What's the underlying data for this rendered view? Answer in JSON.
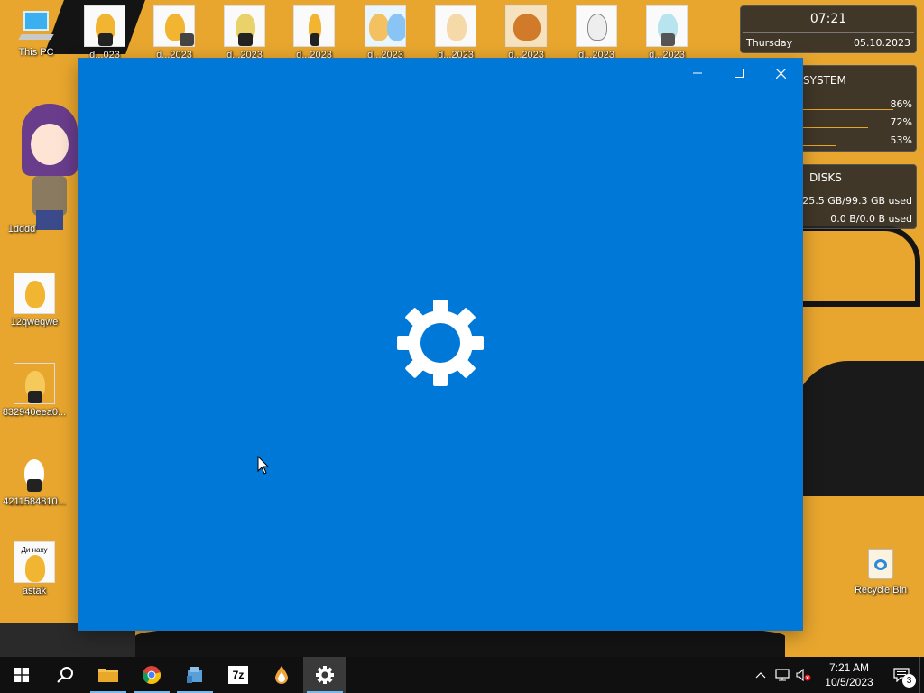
{
  "desktop": {
    "this_pc_label": "This PC",
    "left_icons": [
      {
        "label": "1dddd"
      },
      {
        "label": "12qweqwe"
      },
      {
        "label": "832940eea0..."
      },
      {
        "label": "4211584810..."
      },
      {
        "label": "astak"
      }
    ],
    "top_icons": [
      {
        "label": "d...023"
      },
      {
        "label": "d...2023"
      },
      {
        "label": "d...2023"
      },
      {
        "label": "d...2023"
      },
      {
        "label": "d...2023"
      },
      {
        "label": "d...2023"
      },
      {
        "label": "d...2023"
      },
      {
        "label": "d...2023"
      },
      {
        "label": "d...2023"
      }
    ],
    "recycle_bin_label": "Recycle Bin",
    "meme_caption": "Ди наху"
  },
  "gadgets": {
    "clock": {
      "time": "07:21",
      "day": "Thursday",
      "date": "05.10.2023"
    },
    "system": {
      "title": "SYSTEM",
      "values": [
        "86%",
        "72%",
        "53%"
      ]
    },
    "disks": {
      "title": "DISKS",
      "line1": "25.5 GB/99.3 GB used",
      "line2": "0.0 B/0.0 B used"
    }
  },
  "settings_window": {
    "controls": {
      "minimize": "—",
      "maximize": "☐",
      "close": "✕"
    },
    "background_color": "#0078d7"
  },
  "taskbar": {
    "apps": [
      {
        "name": "start",
        "icon": "windows-logo-icon"
      },
      {
        "name": "search",
        "icon": "search-icon"
      },
      {
        "name": "file-explorer",
        "icon": "folder-icon"
      },
      {
        "name": "chrome",
        "icon": "chrome-icon"
      },
      {
        "name": "app-tool",
        "icon": "tool-icon"
      },
      {
        "name": "7zip",
        "icon": "7z-icon",
        "text": "7z"
      },
      {
        "name": "drop-app",
        "icon": "drop-icon"
      },
      {
        "name": "settings",
        "icon": "gear-icon",
        "active": true
      }
    ],
    "clock": {
      "time": "7:21 AM",
      "date": "10/5/2023"
    },
    "notification_count": "3"
  }
}
